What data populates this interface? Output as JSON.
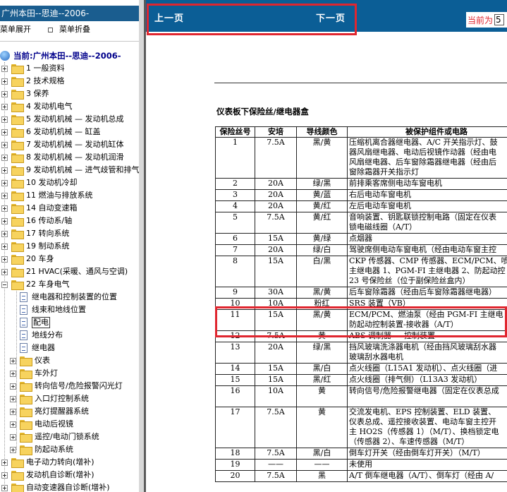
{
  "nav": {
    "title": "广州本田--思迪--2006-",
    "expand_label": "菜单展开",
    "collapse_label": "菜单折叠",
    "root_label": "当前:广州本田--思迪--2006-",
    "items": [
      {
        "label": "1 一般资料"
      },
      {
        "label": "2 技术规格"
      },
      {
        "label": "3 保养"
      },
      {
        "label": "4 发动机电气"
      },
      {
        "label": "5 发动机机械 — 发动机总成"
      },
      {
        "label": "6 发动机机械 — 缸盖"
      },
      {
        "label": "7 发动机机械 — 发动机缸体"
      },
      {
        "label": "8 发动机机械 — 发动机润滑"
      },
      {
        "label": "9 发动机机械 — 进气歧管和排气"
      },
      {
        "label": "10 发动机冷却"
      },
      {
        "label": "11 燃油与排放系统"
      },
      {
        "label": "14 自动变速箱"
      },
      {
        "label": "16 传动系/轴"
      },
      {
        "label": "17 转向系统"
      },
      {
        "label": "19 制动系统"
      },
      {
        "label": "20 车身"
      },
      {
        "label": "21 HVAC(采暖、通风与空调)"
      },
      {
        "label": "22 车身电气"
      }
    ],
    "sub_items": [
      {
        "label": "继电器和控制装置的位置",
        "type": "doc"
      },
      {
        "label": "线束和地线位置",
        "type": "doc"
      },
      {
        "label": "配电",
        "type": "doc",
        "selected": true
      },
      {
        "label": "地线分布",
        "type": "doc"
      },
      {
        "label": "继电器",
        "type": "doc"
      },
      {
        "label": "仪表",
        "type": "folder"
      },
      {
        "label": "车外灯",
        "type": "folder"
      },
      {
        "label": "转向信号/危险报警闪光灯",
        "type": "folder"
      },
      {
        "label": "入口灯控制系统",
        "type": "folder"
      },
      {
        "label": "亮灯提醒器系统",
        "type": "folder"
      },
      {
        "label": "电动后视镜",
        "type": "folder"
      },
      {
        "label": "遥控/电动门锁系统",
        "type": "folder"
      },
      {
        "label": "防起动系统",
        "type": "folder"
      }
    ],
    "tail_items": [
      {
        "label": "电子动力转向(增补)"
      },
      {
        "label": "发动机自诊断(增补)"
      },
      {
        "label": "自动变速器自诊断(增补)"
      }
    ]
  },
  "content": {
    "prev_label": "上一页",
    "next_label": "下一页",
    "page_label": "当前为",
    "page_value": "5",
    "section_title": "仪表板下保险丝/继电器盒",
    "table": {
      "headers": [
        "保险丝号",
        "安培",
        "导线颜色",
        "被保护组件或电路"
      ],
      "rows": [
        {
          "no": "1",
          "amp": "7.5A",
          "color": "黑/黄",
          "lines": 4,
          "desc": "压缩机离合器继电器、A/C 开关指示灯、鼓\n器风扇继电器、电动后视镜作动器（经由电\n风扇继电器、后车窗除霜器继电器（经由后\n窗除霜器开关指示灯"
        },
        {
          "no": "2",
          "amp": "20A",
          "color": "绿/黑",
          "lines": 1,
          "desc": "前排乘客席侧电动车窗电机"
        },
        {
          "no": "3",
          "amp": "20A",
          "color": "黄/蓝",
          "lines": 1,
          "desc": "右后电动车窗电机"
        },
        {
          "no": "4",
          "amp": "20A",
          "color": "黄/红",
          "lines": 1,
          "desc": "左后电动车窗电机"
        },
        {
          "no": "5",
          "amp": "7.5A",
          "color": "黄/红",
          "lines": 2,
          "desc": "音响装置、钥匙联锁控制电路（固定在仪表\n锁电磁线圈（A/T）"
        },
        {
          "no": "6",
          "amp": "15A",
          "color": "黄/绿",
          "lines": 1,
          "desc": "点烟器"
        },
        {
          "no": "7",
          "amp": "20A",
          "color": "绿/白",
          "lines": 1,
          "desc": "驾驶席侧电动车窗电机（经由电动车窗主控"
        },
        {
          "no": "8",
          "amp": "15A",
          "color": "白/黑",
          "lines": 3,
          "desc": "CKP 传感器、CMP 传感器、ECM/PCM、喷\n主继电器 1、PGM-FI 主继电器 2、防起动控\n23 号保险丝（位于副保险丝盒内）"
        },
        {
          "no": "9",
          "amp": "30A",
          "color": "黑/黄",
          "lines": 1,
          "desc": "后车窗除霜器（经由后车窗除霜器继电器）"
        },
        {
          "no": "10",
          "amp": "10A",
          "color": "粉红",
          "lines": 1,
          "desc": "SRS 装置（VB）"
        },
        {
          "no": "11",
          "amp": "15A",
          "color": "黑/黄",
          "lines": 2,
          "desc": "ECM/PCM、燃油泵（经由 PGM-FI 主继电\n防起动控制装置-接收器（A/T）"
        },
        {
          "no": "12",
          "amp": "7.5A",
          "color": "黄",
          "lines": 1,
          "desc": "ABS 调制器 — 控制装置"
        },
        {
          "no": "13",
          "amp": "20A",
          "color": "绿/黑",
          "lines": 2,
          "desc": "挡风玻璃洗涤器电机（经由挡风玻璃刮水器\n玻璃刮水器电机"
        },
        {
          "no": "14",
          "amp": "15A",
          "color": "黑/白",
          "lines": 1,
          "desc": "点火线圈（L15A1 发动机）、点火线圈（进"
        },
        {
          "no": "15",
          "amp": "15A",
          "color": "黑/红",
          "lines": 1,
          "desc": "点火线圈（排气侧）（L13A3 发动机）"
        },
        {
          "no": "16",
          "amp": "10A",
          "color": "黄",
          "lines": 2,
          "desc": "转向信号/危险报警继电器（固定在仪表总成\n"
        },
        {
          "no": "17",
          "amp": "7.5A",
          "color": "黄",
          "lines": 4,
          "desc": "交流发电机、EPS 控制装置、ELD 装置、\n仪表总成、遥控接收装置、电动车窗主控开\n主 HO2S（传感器 1）（M/T）、换档锁定电\n（传感器 2）、车速传感器（M/T）"
        },
        {
          "no": "18",
          "amp": "7.5A",
          "color": "黑/白",
          "lines": 1,
          "desc": "倒车灯开关（经由倒车灯开关）（M/T）"
        },
        {
          "no": "19",
          "amp": "——",
          "color": "——",
          "lines": 1,
          "desc": "未使用"
        },
        {
          "no": "20",
          "amp": "7.5A",
          "color": "黑",
          "lines": 1,
          "desc": "A/T 倒车继电器（A/T）、倒车灯（经由 A/"
        }
      ]
    }
  }
}
